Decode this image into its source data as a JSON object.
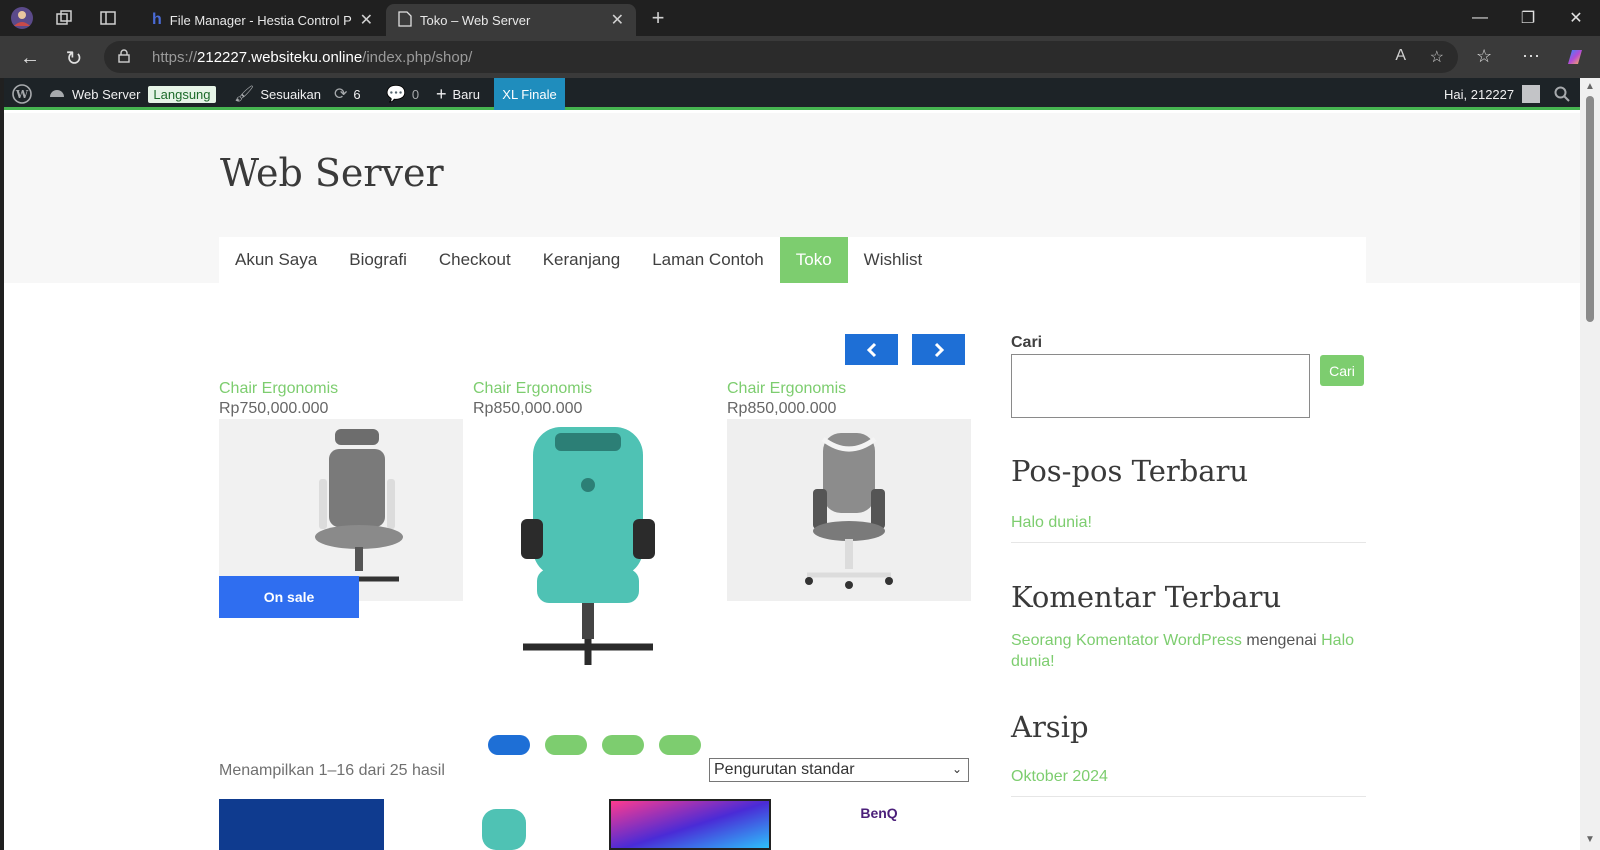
{
  "browser": {
    "tabs": [
      {
        "title": "File Manager - Hestia Control Pan",
        "active": false
      },
      {
        "title": "Toko – Web Server",
        "active": true
      }
    ],
    "url_prefix": "https://",
    "url_domain": "212227.websiteku.online",
    "url_path": "/index.php/shop/"
  },
  "adminbar": {
    "site_name": "Web Server",
    "live_badge": "Langsung",
    "customize": "Sesuaikan",
    "updates_count": "6",
    "comments_count": "0",
    "new_label": "Baru",
    "plugin_label": "XL Finale",
    "greeting": "Hai, 212227"
  },
  "site": {
    "title": "Web Server",
    "nav": [
      {
        "label": "Akun Saya",
        "active": false
      },
      {
        "label": "Biografi",
        "active": false
      },
      {
        "label": "Checkout",
        "active": false
      },
      {
        "label": "Keranjang",
        "active": false
      },
      {
        "label": "Laman Contoh",
        "active": false
      },
      {
        "label": "Toko",
        "active": true
      },
      {
        "label": "Wishlist",
        "active": false
      }
    ]
  },
  "carousel": {
    "products": [
      {
        "name": "Chair Ergonomis",
        "price": "Rp750,000.000",
        "image": "office-chair-grey-icon"
      },
      {
        "name": "Chair Ergonomis",
        "price": "Rp850,000.000",
        "image": "gaming-chair-teal-icon"
      },
      {
        "name": "Chair Ergonomis",
        "price": "Rp850,000.000",
        "image": "office-chair-back-icon"
      }
    ],
    "sale_badge": "On sale",
    "dots": 4,
    "active_dot": 0
  },
  "shop": {
    "result_count": "Menampilkan 1–16 dari 25 hasil",
    "orderby_selected": "Pengurutan standar",
    "thumb_brand": "BenQ"
  },
  "sidebar": {
    "search_label": "Cari",
    "search_button": "Cari",
    "recent_posts_title": "Pos-pos Terbaru",
    "recent_post": "Halo dunia!",
    "recent_comments_title": "Komentar Terbaru",
    "comment_author": "Seorang Komentator WordPress",
    "comment_on": "mengenai",
    "comment_post": "Halo dunia!",
    "archives_title": "Arsip",
    "archive_item": "Oktober 2024"
  },
  "colors": {
    "accent_green": "#7dcd6f",
    "carousel_blue": "#1e6fd6",
    "sale_blue": "#2f6ef0",
    "adminbar": "#1d2327"
  }
}
